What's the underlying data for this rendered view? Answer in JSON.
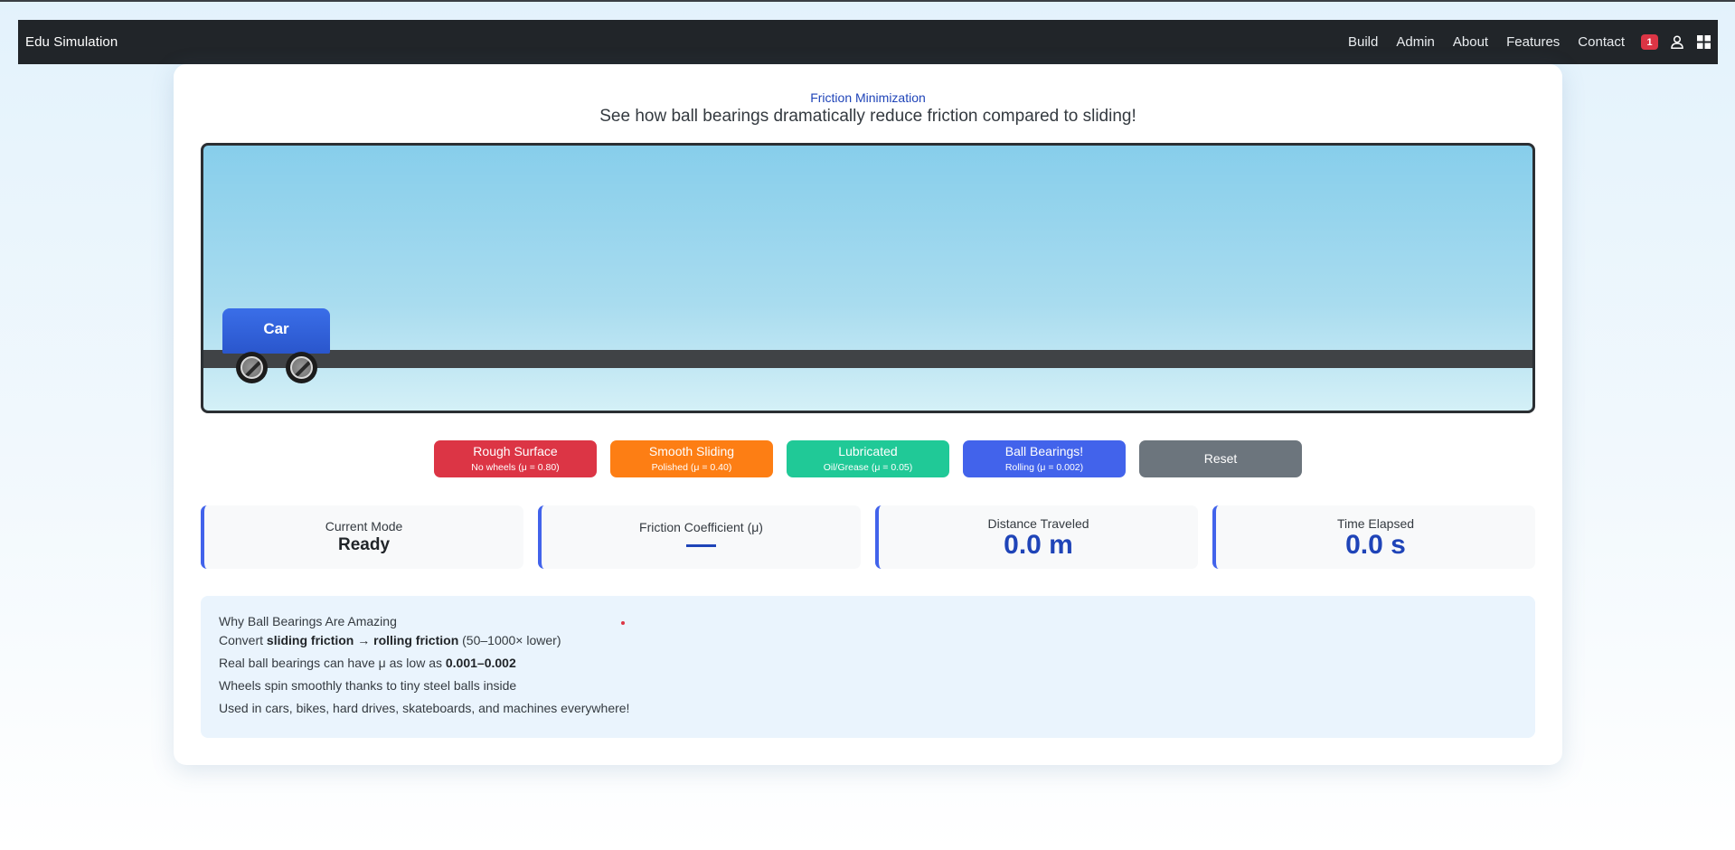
{
  "nav": {
    "brand": "Edu Simulation",
    "links": [
      "Build",
      "Admin",
      "About",
      "Features",
      "Contact"
    ],
    "badge_count": "1",
    "icons": [
      "user-icon",
      "grid-icon"
    ]
  },
  "header": {
    "subtitle": "Friction Minimization",
    "headline": "See how ball bearings dramatically reduce friction compared to sliding!"
  },
  "simulation": {
    "car_label": "Car",
    "colors": {
      "sky_top": "#87ceeb",
      "sky_bottom": "#d4f0f7",
      "car": "#2a56cc",
      "track": "#404346"
    }
  },
  "controls": [
    {
      "title": "Rough Surface",
      "sub": "No wheels (μ = 0.80)",
      "color": "#dc3545"
    },
    {
      "title": "Smooth Sliding",
      "sub": "Polished (μ = 0.40)",
      "color": "#fd7e14"
    },
    {
      "title": "Lubricated",
      "sub": "Oil/Grease (μ = 0.05)",
      "color": "#20c997"
    },
    {
      "title": "Ball Bearings!",
      "sub": "Rolling (μ = 0.002)",
      "color": "#4263eb"
    },
    {
      "title": "Reset",
      "color": "#6c757d"
    }
  ],
  "stats": {
    "mode_label": "Current Mode",
    "mode_value": "Ready",
    "friction_label": "Friction Coefficient (μ)",
    "distance_label": "Distance Traveled",
    "distance_value": "0.0 m",
    "time_label": "Time Elapsed",
    "time_value": "0.0 s"
  },
  "info": {
    "title": "Why Ball Bearings Are Amazing",
    "line1_pre": "Convert ",
    "line1_bold": "sliding friction → rolling friction",
    "line1_post": " (50–1000× lower)",
    "line2_pre": "Real ball bearings can have μ as low as ",
    "line2_bold": "0.001–0.002",
    "line3": "Wheels spin smoothly thanks to tiny steel balls inside",
    "line4": "Used in cars, bikes, hard drives, skateboards, and machines everywhere!"
  }
}
